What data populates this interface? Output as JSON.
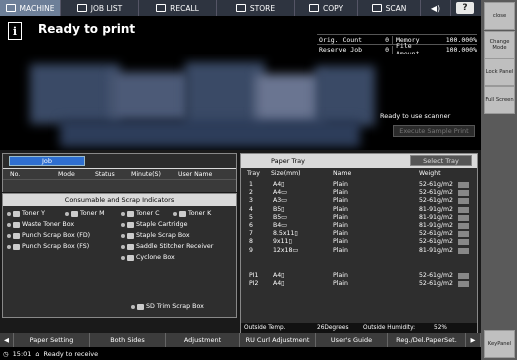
{
  "tabs": [
    {
      "label": "MACHINE",
      "icon": "printer-icon"
    },
    {
      "label": "JOB LIST",
      "icon": "joblist-icon"
    },
    {
      "label": "RECALL",
      "icon": "recall-icon"
    },
    {
      "label": "STORE",
      "icon": "store-icon"
    },
    {
      "label": "COPY",
      "icon": "copy-icon"
    },
    {
      "label": "SCAN",
      "icon": "scan-icon"
    }
  ],
  "volume_glyph": "◀)",
  "help_label": "?",
  "status": {
    "message": "Ready to print",
    "info_glyph": "i"
  },
  "counters": {
    "orig_count_label": "Orig. Count",
    "orig_count_value": "0",
    "memory_label": "Memory",
    "memory_value": "100.000%",
    "reserve_job_label": "Reserve Job",
    "reserve_job_value": "0",
    "file_amount_label": "File Amount",
    "file_amount_value": "100.000%"
  },
  "scanner_message": "Ready to use scanner",
  "execute_sample_print": "Execute Sample Print",
  "job_panel": {
    "tab_label": "Job",
    "columns": [
      "No.",
      "Mode",
      "Status",
      "Minute(S)",
      "User Name"
    ]
  },
  "consumables": {
    "title": "Consumable and Scrap Indicators",
    "items": [
      "Toner Y",
      "Toner M",
      "Toner C",
      "Toner K",
      "Waste Toner Box",
      "Staple Cartridge",
      "Punch Scrap Box (FD)",
      "Staple Scrap Box",
      "Punch Scrap Box (FS)",
      "Saddle Stitcher Receiver",
      "Cyclone Box",
      "SD Trim Scrap Box"
    ]
  },
  "paper_tray": {
    "title": "Paper Tray",
    "select_tray": "Select Tray",
    "columns": [
      "Tray",
      "Size(mm)",
      "Name",
      "Weight"
    ],
    "rows": [
      {
        "tray": "1",
        "size": "A4▯",
        "name": "Plain",
        "weight": "52-61g/m2"
      },
      {
        "tray": "2",
        "size": "A4▭",
        "name": "Plain",
        "weight": "52-61g/m2"
      },
      {
        "tray": "3",
        "size": "A3▭",
        "name": "Plain",
        "weight": "52-61g/m2"
      },
      {
        "tray": "4",
        "size": "B5▯",
        "name": "Plain",
        "weight": "81-91g/m2"
      },
      {
        "tray": "5",
        "size": "B5▭",
        "name": "Plain",
        "weight": "81-91g/m2"
      },
      {
        "tray": "6",
        "size": "B4▭",
        "name": "Plain",
        "weight": "81-91g/m2"
      },
      {
        "tray": "7",
        "size": "8.5x11▯",
        "name": "Plain",
        "weight": "52-61g/m2"
      },
      {
        "tray": "8",
        "size": "9x11▯",
        "name": "Plain",
        "weight": "52-61g/m2"
      },
      {
        "tray": "9",
        "size": "12x18▭",
        "name": "Plain",
        "weight": "81-91g/m2"
      },
      {
        "tray": "PI1",
        "size": "A4▯",
        "name": "Plain",
        "weight": "52-61g/m2"
      },
      {
        "tray": "PI2",
        "size": "A4▯",
        "name": "Plain",
        "weight": "52-61g/m2"
      }
    ],
    "outside_temp_label": "Outside Temp.",
    "outside_temp_value": "26Degrees",
    "outside_humidity_label": "Outside Humidity:",
    "outside_humidity_value": "52%"
  },
  "function_bar": [
    "Paper Setting",
    "Both Sides",
    "Adjustment",
    "RU Curl Adjustment",
    "User's Guide",
    "Reg./Del.PaperSet."
  ],
  "status_bar": {
    "time": "15:01",
    "message": "Ready to receive"
  },
  "sidebar": [
    "close",
    "Change Mode",
    "Lock Panel",
    "Full Screen",
    "KeyPanel"
  ]
}
